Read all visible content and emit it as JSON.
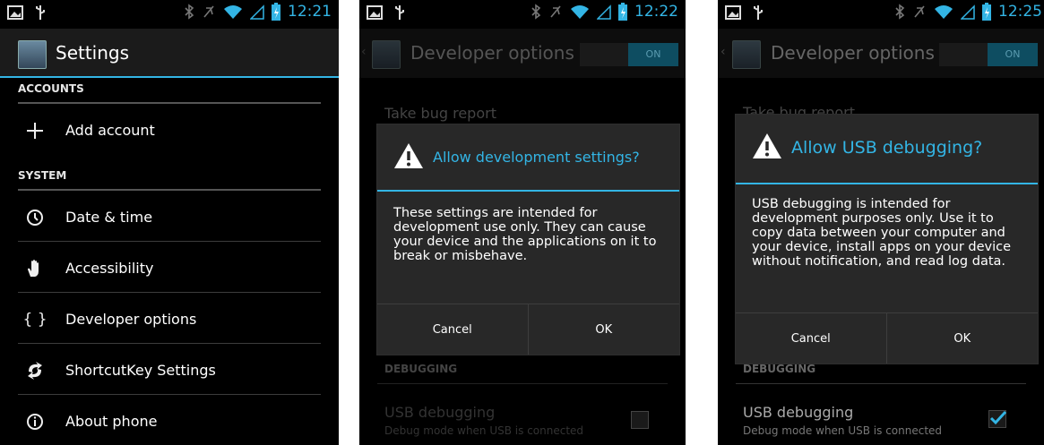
{
  "screen1": {
    "time": "12:21",
    "title": "Settings",
    "sections": {
      "accounts": "ACCOUNTS",
      "system": "SYSTEM"
    },
    "add_account": "Add account",
    "items": [
      {
        "label": "Date & time",
        "icon": "clock-icon"
      },
      {
        "label": "Accessibility",
        "icon": "hand-icon"
      },
      {
        "label": "Developer options",
        "icon": "braces-icon"
      },
      {
        "label": "ShortcutKey Settings",
        "icon": "shortcut-icon"
      },
      {
        "label": "About phone",
        "icon": "info-icon"
      }
    ]
  },
  "screen2": {
    "time": "12:22",
    "title": "Developer options",
    "toggle": "ON",
    "bg_item": "Take bug report",
    "debugging": "DEBUGGING",
    "usb_title": "USB debugging",
    "usb_sub": "Debug mode when USB is connected",
    "dialog": {
      "title": "Allow development settings?",
      "message": "These settings are intended for development use only. They can cause your device and the applications on it to break or misbehave.",
      "cancel": "Cancel",
      "ok": "OK"
    }
  },
  "screen3": {
    "time": "12:25",
    "title": "Developer options",
    "toggle": "ON",
    "bg_item": "Take bug report",
    "debugging": "DEBUGGING",
    "usb_title": "USB debugging",
    "usb_sub": "Debug mode when USB is connected",
    "dialog": {
      "title": "Allow USB debugging?",
      "message": "USB debugging is intended for development purposes only. Use it to copy data between your computer and your device, install apps on your device without notification, and read log data.",
      "cancel": "Cancel",
      "ok": "OK"
    }
  },
  "colors": {
    "accent": "#33b5e5",
    "background": "#000000",
    "dialog": "#282828"
  }
}
